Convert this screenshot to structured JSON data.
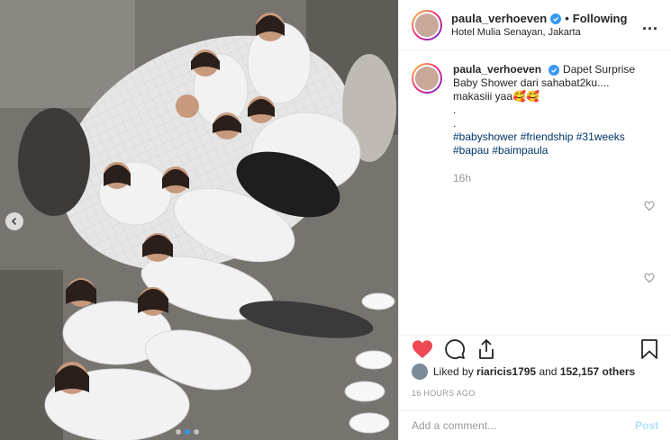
{
  "post": {
    "username": "paula_verhoeven",
    "follow_separator": "•",
    "follow_status": "Following",
    "location": "Hotel Mulia Senayan, Jakarta",
    "more_label": "...",
    "caption_text": "Dapet Surprise Baby Shower dari sahabat2ku.... makasiii yaa🥰🥰",
    "caption_dots": ".\n.",
    "hashtags": "#babyshower #friendship #31weeks #bapau #baimpaula",
    "caption_time": "16h",
    "liked_prefix": "Liked by",
    "liked_user": "riaricis1795",
    "liked_and": "and",
    "liked_count": "152,157 others",
    "posted_ago": "16 HOURS AGO",
    "comment_placeholder": "Add a comment...",
    "post_button": "Post"
  },
  "icons": {
    "like": "heart-icon (filled red)",
    "comment": "comment-icon",
    "share": "share-icon",
    "save": "bookmark-icon",
    "verified": "verified-badge-icon",
    "carousel_prev": "chevron-left-icon",
    "comment_like": "small-heart-icon"
  },
  "colors": {
    "like_red": "#ed4956",
    "verified_blue": "#3897f0",
    "hashtag_blue": "#003569",
    "muted": "#999999"
  }
}
